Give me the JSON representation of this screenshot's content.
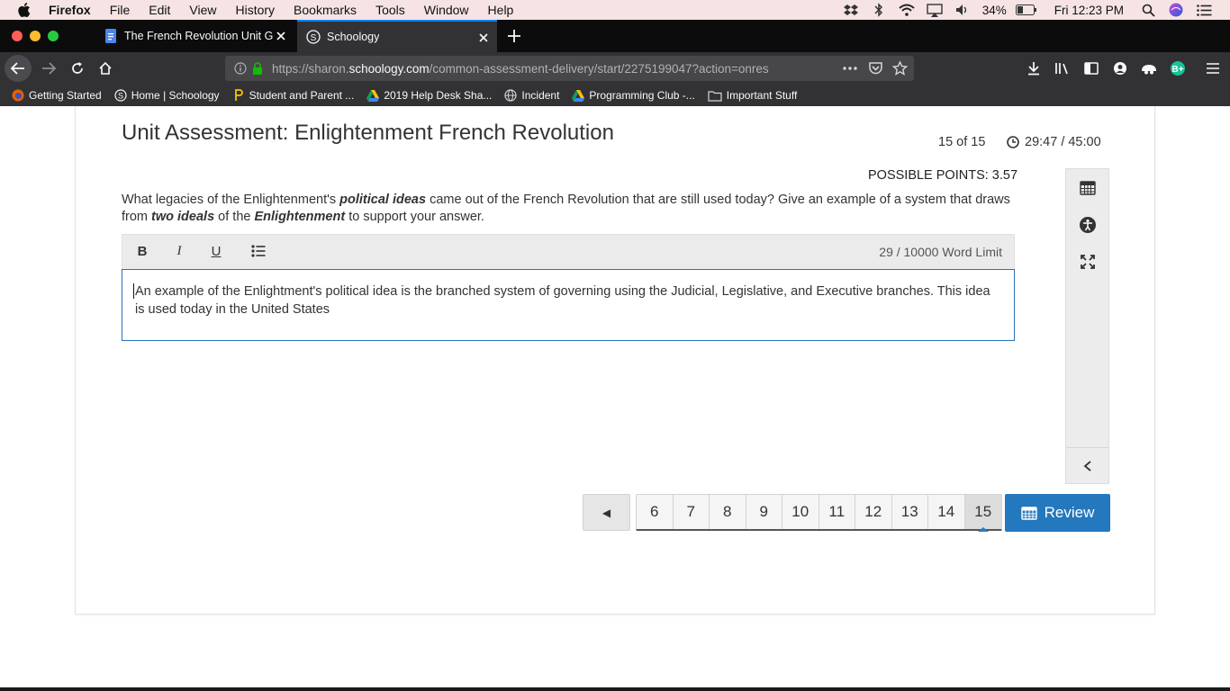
{
  "menubar": {
    "items": [
      "Firefox",
      "File",
      "Edit",
      "View",
      "History",
      "Bookmarks",
      "Tools",
      "Window",
      "Help"
    ],
    "battery": "34%",
    "clock": "Fri 12:23 PM"
  },
  "tabs": [
    {
      "title": "The French Revolution Unit Gui"
    },
    {
      "title": "Schoology"
    }
  ],
  "navbar": {
    "url_prefix": "https://sharon.",
    "url_host": "schoology.com",
    "url_path": "/common-assessment-delivery/start/2275199047?action=onres"
  },
  "bookmarks": [
    {
      "label": "Getting Started",
      "icon": "firefox-icon"
    },
    {
      "label": "Home | Schoology",
      "icon": "schoology-icon"
    },
    {
      "label": "Student and Parent ...",
      "icon": "p-icon"
    },
    {
      "label": "2019 Help Desk Sha...",
      "icon": "drive-icon"
    },
    {
      "label": "Incident",
      "icon": "globe-icon"
    },
    {
      "label": "Programming Club -...",
      "icon": "drive-icon"
    },
    {
      "label": "Important Stuff",
      "icon": "folder-icon"
    }
  ],
  "assessment": {
    "title": "Unit Assessment: Enlightenment French Revolution",
    "progress": "15 of 15",
    "timer": "29:47 / 45:00",
    "possible_points": "POSSIBLE POINTS: 3.57",
    "question": {
      "p1": "What legacies of the Enlightenment's ",
      "b1": "political ideas",
      "p2": " came out of the French Revolution that are still used today? Give an example of a system that draws from ",
      "b2": "two ideals",
      "p3": " of the ",
      "b3": "Enlightenment",
      "p4": " to support your answer."
    },
    "toolbar": {
      "bold": "B",
      "italic": "I",
      "underline": "U",
      "word_limit": "29  /  10000 Word Limit"
    },
    "answer": "An example of the Enlightment's political idea is the branched system of governing using the Judicial, Legislative, and Executive branches. This idea is used today in the United States"
  },
  "pagination": {
    "prev": "◀",
    "pages": [
      "6",
      "7",
      "8",
      "9",
      "10",
      "11",
      "12",
      "13",
      "14",
      "15"
    ],
    "active_page": "15",
    "review": "Review"
  },
  "colors": {
    "accent": "#2478bd",
    "menubar_bg": "#f6e4e4",
    "tabbar_bg": "#0c0c0d",
    "navbar_bg": "#323234"
  }
}
